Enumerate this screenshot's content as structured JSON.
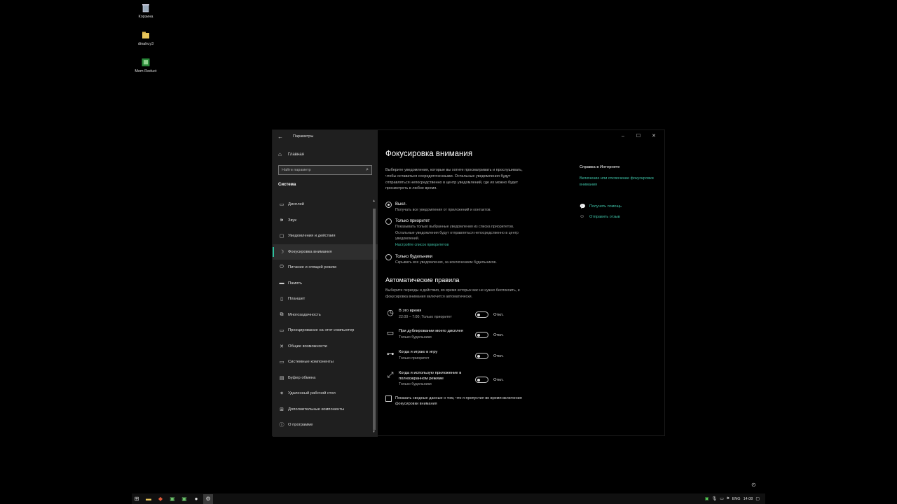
{
  "desktop": {
    "icons": [
      {
        "label": "Корзина",
        "icon": "recycle-bin-icon"
      },
      {
        "label": "dinahuy3",
        "icon": "folder-icon"
      },
      {
        "label": "Mem Reduct",
        "icon": "app-icon"
      }
    ]
  },
  "window": {
    "title": "Параметры",
    "controls": {
      "minimize": "‒",
      "maximize": "☐",
      "close": "✕"
    }
  },
  "sidebar": {
    "home": "Главная",
    "search_placeholder": "Найти параметр",
    "section": "Система",
    "items": [
      {
        "label": "Дисплей",
        "icon": "display-icon",
        "glyph": "▭"
      },
      {
        "label": "Звук",
        "icon": "sound-icon",
        "glyph": "🕪"
      },
      {
        "label": "Уведомления и действия",
        "icon": "notifications-icon",
        "glyph": "▢"
      },
      {
        "label": "Фокусировка внимания",
        "icon": "focus-assist-icon",
        "glyph": "☽",
        "active": true
      },
      {
        "label": "Питание и спящий режим",
        "icon": "power-icon",
        "glyph": "⏻"
      },
      {
        "label": "Память",
        "icon": "storage-icon",
        "glyph": "▬"
      },
      {
        "label": "Планшет",
        "icon": "tablet-icon",
        "glyph": "▯"
      },
      {
        "label": "Многозадачность",
        "icon": "multitasking-icon",
        "glyph": "⧉"
      },
      {
        "label": "Проецирование на этот компьютер",
        "icon": "projection-icon",
        "glyph": "▭"
      },
      {
        "label": "Общие возможности",
        "icon": "shared-experiences-icon",
        "glyph": "✕"
      },
      {
        "label": "Системные компоненты",
        "icon": "system-components-icon",
        "glyph": "▭"
      },
      {
        "label": "Буфер обмена",
        "icon": "clipboard-icon",
        "glyph": "▤"
      },
      {
        "label": "Удаленный рабочий стол",
        "icon": "remote-desktop-icon",
        "glyph": "✶"
      },
      {
        "label": "Дополнительные компоненты",
        "icon": "optional-features-icon",
        "glyph": "⊞"
      },
      {
        "label": "О программе",
        "icon": "about-icon",
        "glyph": "ⓘ"
      }
    ]
  },
  "main": {
    "title": "Фокусировка внимания",
    "description": "Выберите уведомления, которые вы хотите просматривать и прослушивать, чтобы оставаться сосредоточенными. Остальные уведомления будут отправляться непосредственно в центр уведомлений, где их можно будет просмотреть в любое время.",
    "options": {
      "off": {
        "title": "Выкл.",
        "desc": "Получать все уведомления от приложений и контактов."
      },
      "priority": {
        "title": "Только приоритет",
        "desc": "Показывать только выбранные уведомления из списка приоритетов. Остальные уведомления будут отправляться непосредственно в центр уведомлений.",
        "link": "Настройте список приоритетов"
      },
      "alarms": {
        "title": "Только будильники",
        "desc": "Скрывать все уведомления, за исключением будильников."
      }
    },
    "auto_title": "Автоматические правила",
    "auto_desc": "Выберите периоды и действия, во время которых вас не нужно беспокоить, и фокусировка внимания включится автоматически.",
    "rules": {
      "time": {
        "title": "В это время",
        "desc": "22:00 – 7:00; Только приоритет",
        "state": "Откл."
      },
      "display": {
        "title": "При дублировании моего дисплея",
        "desc": "Только будильники",
        "state": "Откл."
      },
      "game": {
        "title": "Когда я играю в игру",
        "desc": "Только приоритет",
        "state": "Откл."
      },
      "fullscreen": {
        "title": "Когда я использую приложение в полноэкранном режиме",
        "desc": "Только будильники",
        "state": "Откл."
      }
    },
    "summary_checkbox": "Показать сводные данные о том, что я пропустил во время включения фокусировки внимания"
  },
  "help": {
    "heading": "Справка в Интернете",
    "link": "Включение или отключение фокусировки внимания",
    "get_help": "Получить помощь",
    "feedback": "Отправить отзыв"
  },
  "taskbar": {
    "lang": "ENG",
    "time": "14:08"
  }
}
